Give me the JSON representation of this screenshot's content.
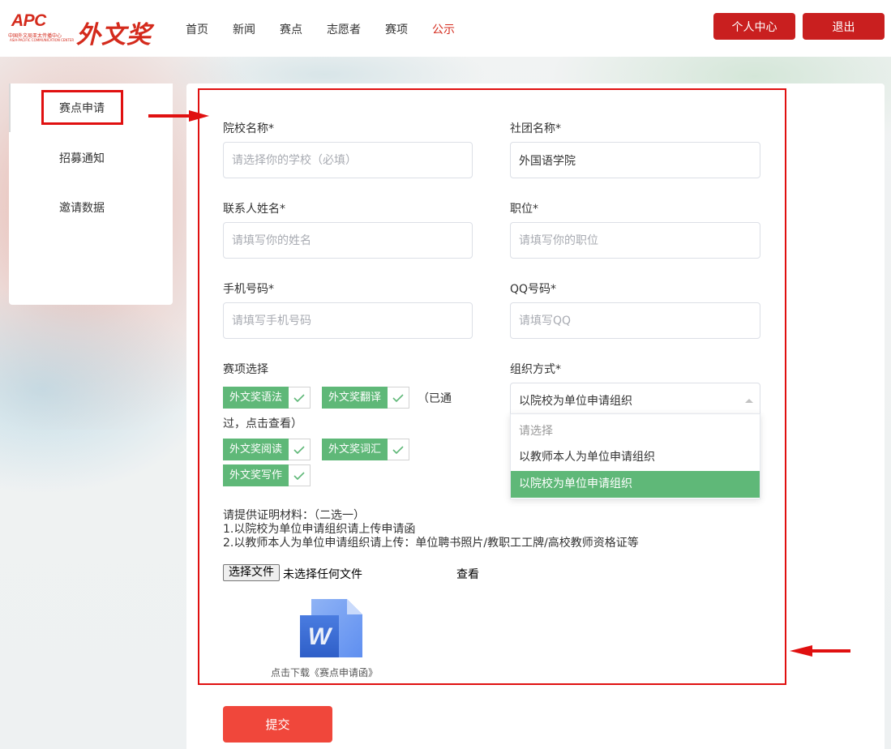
{
  "header": {
    "logo_apc": "APC",
    "logo_sub": "中国外文局亚太传播中心",
    "logo_sub2": "ASIA-PACIFIC COMMUNICATION CENTER",
    "logo_cn": "外文奖",
    "nav": [
      "首页",
      "新闻",
      "赛点",
      "志愿者",
      "赛项",
      "公示"
    ],
    "active_nav": "公示",
    "personal_center": "个人中心",
    "logout": "退出"
  },
  "sidebar": {
    "items": [
      {
        "label": "赛点申请",
        "active": true
      },
      {
        "label": "招募通知",
        "active": false
      },
      {
        "label": "邀请数据",
        "active": false
      }
    ]
  },
  "form": {
    "school": {
      "label": "院校名称*",
      "value": "",
      "placeholder": "请选择你的学校（必填）"
    },
    "club": {
      "label": "社团名称*",
      "value": "外国语学院",
      "placeholder": ""
    },
    "contact": {
      "label": "联系人姓名*",
      "value": "",
      "placeholder": "请填写你的姓名"
    },
    "position": {
      "label": "职位*",
      "value": "",
      "placeholder": "请填写你的职位"
    },
    "phone": {
      "label": "手机号码*",
      "value": "",
      "placeholder": "请填写手机号码"
    },
    "qq": {
      "label": "QQ号码*",
      "value": "",
      "placeholder": "请填写QQ"
    },
    "events": {
      "label": "赛项选择",
      "options": [
        {
          "label": "外文奖语法",
          "checked": true
        },
        {
          "label": "外文奖翻译",
          "checked": true
        },
        {
          "label": "外文奖阅读",
          "checked": true
        },
        {
          "label": "外文奖词汇",
          "checked": true
        },
        {
          "label": "外文奖写作",
          "checked": true
        }
      ],
      "note_line1": "（已通",
      "note_line2": "过，点击查看）"
    },
    "org": {
      "label": "组织方式*",
      "selected": "以院校为单位申请组织",
      "options": [
        {
          "label": "请选择",
          "placeholder": true
        },
        {
          "label": "以教师本人为单位申请组织",
          "placeholder": false
        },
        {
          "label": "以院校为单位申请组织",
          "placeholder": false
        }
      ]
    },
    "proof": {
      "line1": "请提供证明材料：（二选一）",
      "line2": "1.以院校为单位申请组织请上传申请函",
      "line3": "2.以教师本人为单位申请组织请上传：单位聘书照片/教职工工牌/高校教师资格证等"
    },
    "file": {
      "button": "选择文件",
      "status": "未选择任何文件",
      "view": "查看"
    },
    "download": "点击下载《赛点申请函》",
    "download_icon": "word-doc-icon",
    "submit": "提交"
  },
  "colors": {
    "brand_red": "#c91f1f",
    "accent_green": "#5fb878",
    "submit_red": "#f0473b",
    "highlight_red": "#e01010"
  }
}
